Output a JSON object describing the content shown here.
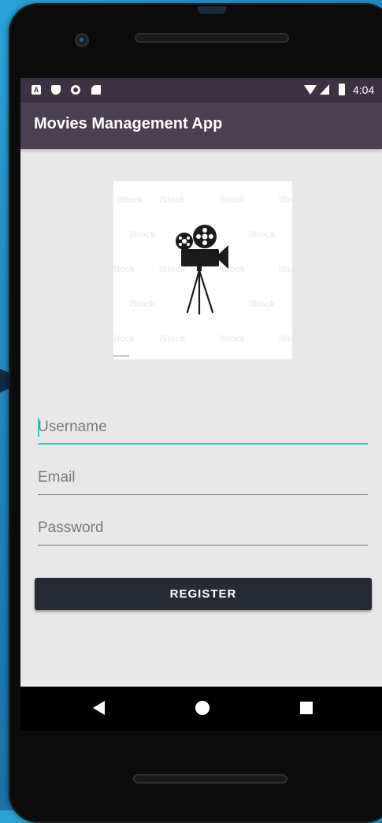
{
  "status_bar": {
    "time": "4:04",
    "left_icons": [
      "a-box-icon",
      "shield-icon",
      "circle-icon",
      "sd-card-icon"
    ],
    "right_icons": [
      "wifi-icon",
      "signal-icon",
      "battery-icon"
    ]
  },
  "app_bar": {
    "title": "Movies Management App"
  },
  "logo": {
    "icon": "movie-camera-icon",
    "watermark": "iStock"
  },
  "form": {
    "username": {
      "placeholder": "Username",
      "value": "",
      "focused": true
    },
    "email": {
      "placeholder": "Email",
      "value": ""
    },
    "password": {
      "placeholder": "Password",
      "value": ""
    },
    "register_label": "REGISTER"
  },
  "nav_bar": {
    "buttons": [
      "back-icon",
      "home-icon",
      "recents-icon"
    ]
  },
  "colors": {
    "app_bar": "#4b3f52",
    "status_bar": "#3c3243",
    "accent": "#2ecfc1",
    "button": "#252a33",
    "screen_bg": "#e8e8e8"
  }
}
